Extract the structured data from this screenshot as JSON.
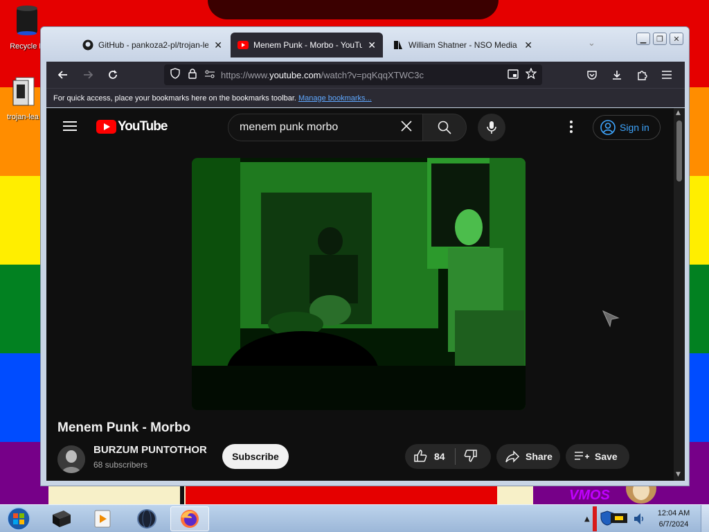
{
  "desktop": {
    "icons": [
      {
        "label": "Recycle B"
      },
      {
        "label": "trojan-lea"
      }
    ],
    "stripe_colors": [
      "#e50000",
      "#ff8d00",
      "#ffee00",
      "#028121",
      "#004cff",
      "#760088"
    ],
    "bottom_text": "VMOS"
  },
  "browser": {
    "tabs": [
      {
        "label": "GitHub - pankoza2-pl/trojan-le",
        "icon": "github-icon"
      },
      {
        "label": "Menem Punk - Morbo - YouTub",
        "icon": "youtube-icon"
      },
      {
        "label": "William Shatner - NSO Media La",
        "icon": "nso-icon"
      }
    ],
    "url_prefix": "https://www.",
    "url_domain": "youtube.com",
    "url_path": "/watch?v=pqKqqXTWC3c",
    "bookmarks_message": "For quick access, place your bookmarks here on the bookmarks toolbar.",
    "bookmarks_link": "Manage bookmarks..."
  },
  "youtube": {
    "logo_text": "YouTube",
    "search_value": "menem punk morbo",
    "signin_label": "Sign in",
    "video_title": "Menem Punk - Morbo",
    "channel_name": "BURZUM PUNTOTHOR",
    "subscribers": "68 subscribers",
    "subscribe_label": "Subscribe",
    "like_count": "84",
    "share_label": "Share",
    "save_label": "Save",
    "accent": "#ff0000",
    "link_color": "#3ea6ff"
  },
  "taskbar": {
    "time": "12:04 AM",
    "date": "6/7/2024"
  }
}
